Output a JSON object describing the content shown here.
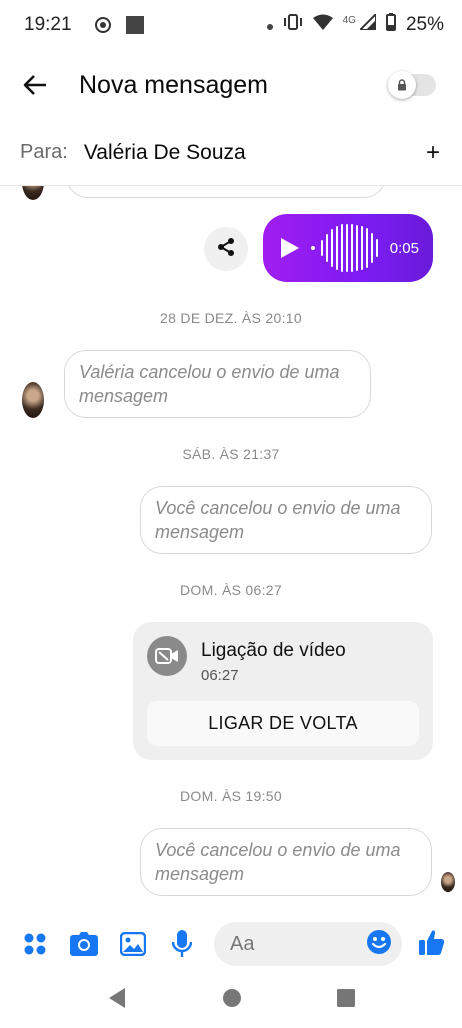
{
  "status_bar": {
    "time": "19:21",
    "network": "4G",
    "battery": "25%"
  },
  "header": {
    "title": "Nova mensagem",
    "toggle_on": false
  },
  "recipient": {
    "label": "Para:",
    "name": "Valéria De Souza",
    "add_symbol": "+"
  },
  "messages": {
    "voice_duration": "0:05",
    "ts1": "28 DE DEZ. ÀS 20:10",
    "msg1": "Valéria cancelou o envio de uma mensagem",
    "ts2": "SÁB. ÀS 21:37",
    "msg2": "Você cancelou o envio de uma mensagem",
    "ts3": "DOM. ÀS 06:27",
    "call_title": "Ligação de vídeo",
    "call_time": "06:27",
    "call_button": "LIGAR DE VOLTA",
    "ts4": "DOM. ÀS 19:50",
    "msg3": "Você cancelou o envio de uma mensagem"
  },
  "composer": {
    "placeholder": "Aa"
  },
  "colors": {
    "accent_blue": "#1877f2",
    "voice_gradient_start": "#a11df0",
    "voice_gradient_end": "#6a1bd9"
  }
}
